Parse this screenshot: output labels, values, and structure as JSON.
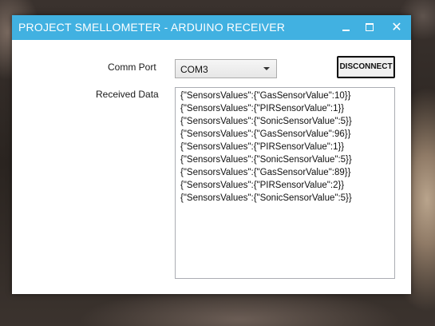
{
  "window": {
    "title": "PROJECT SMELLOMETER - ARDUINO RECEIVER",
    "accent_color": "#41b1e1",
    "controls": {
      "minimize": "minimize-icon",
      "maximize": "maximize-icon",
      "close": "close-icon"
    }
  },
  "form": {
    "comm_port_label": "Comm Port",
    "comm_port_value": "COM3",
    "disconnect_label": "DISCONNECT",
    "received_label": "Received Data",
    "received_lines": [
      "{\"SensorsValues\":{\"GasSensorValue\":10}}",
      "{\"SensorsValues\":{\"PIRSensorValue\":1}}",
      "{\"SensorsValues\":{\"SonicSensorValue\":5}}",
      "{\"SensorsValues\":{\"GasSensorValue\":96}}",
      "{\"SensorsValues\":{\"PIRSensorValue\":1}}",
      "{\"SensorsValues\":{\"SonicSensorValue\":5}}",
      "{\"SensorsValues\":{\"GasSensorValue\":89}}",
      "{\"SensorsValues\":{\"PIRSensorValue\":2}}",
      "{\"SensorsValues\":{\"SonicSensorValue\":5}}"
    ]
  }
}
